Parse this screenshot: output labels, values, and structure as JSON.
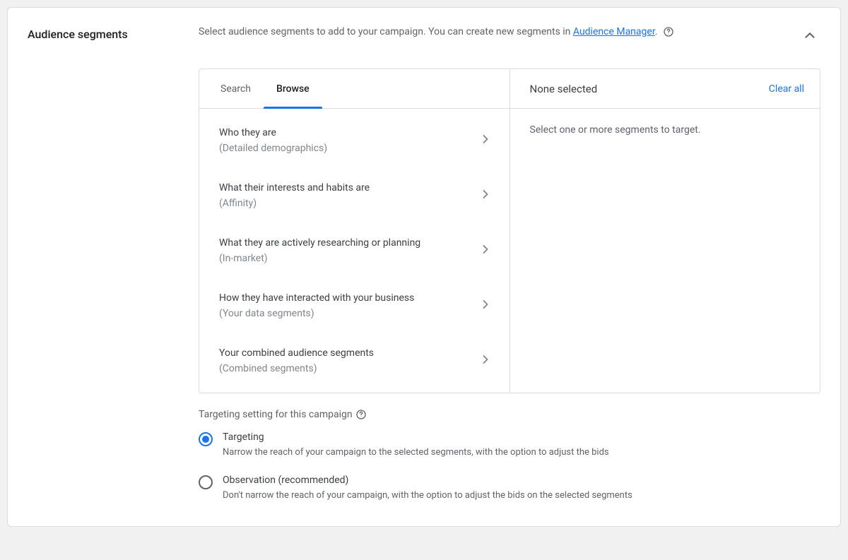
{
  "section_title": "Audience segments",
  "description_part1": "Select audience segments to add to your campaign. You can create new segments in ",
  "description_link": "Audience Manager",
  "description_part2": ".",
  "tabs": {
    "search": "Search",
    "browse": "Browse"
  },
  "categories": [
    {
      "title": "Who they are",
      "subtitle": "(Detailed demographics)"
    },
    {
      "title": "What their interests and habits are",
      "subtitle": "(Affinity)"
    },
    {
      "title": "What they are actively researching or planning",
      "subtitle": "(In-market)"
    },
    {
      "title": "How they have interacted with your business",
      "subtitle": "(Your data segments)"
    },
    {
      "title": "Your combined audience segments",
      "subtitle": "(Combined segments)"
    }
  ],
  "selected_panel": {
    "heading": "None selected",
    "clear_all": "Clear all",
    "empty_text": "Select one or more segments to target."
  },
  "targeting": {
    "heading": "Targeting setting for this campaign",
    "options": [
      {
        "label": "Targeting",
        "desc": "Narrow the reach of your campaign to the selected segments, with the option to adjust the bids",
        "checked": true
      },
      {
        "label": "Observation (recommended)",
        "desc": "Don't narrow the reach of your campaign, with the option to adjust the bids on the selected segments",
        "checked": false
      }
    ]
  }
}
